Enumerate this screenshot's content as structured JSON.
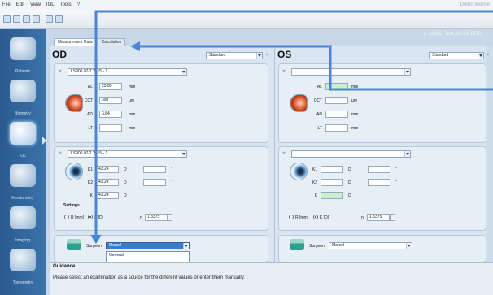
{
  "menu": {
    "items": [
      "File",
      "Edit",
      "View",
      "IOL",
      "Tools",
      "?"
    ],
    "watermark": "Demo license"
  },
  "patient": {
    "label": "12345, Test, 01.01.1950"
  },
  "sidebar": [
    {
      "label": "Patients",
      "icon": "patient-icon"
    },
    {
      "label": "Biometry",
      "icon": "biometry-icon"
    },
    {
      "label": "IOL",
      "icon": "iol-icon"
    },
    {
      "label": "Keratometry",
      "icon": "keratometry-icon"
    },
    {
      "label": "Imaging",
      "icon": "imaging-icon"
    },
    {
      "label": "Tomometry",
      "icon": "tomometry-icon"
    }
  ],
  "tabs": [
    "Measurement Data",
    "Calculation"
  ],
  "od": {
    "title": "OD",
    "mode": "Standard",
    "source_top": "LS900 07/7 2015 - 1",
    "fields": [
      {
        "label": "AL",
        "value": "23.89",
        "unit": "mm"
      },
      {
        "label": "CCT",
        "value": "398",
        "unit": "µm"
      },
      {
        "label": "AD",
        "value": "3.84",
        "unit": "mm"
      },
      {
        "label": "LT",
        "value": "",
        "unit": "mm"
      }
    ],
    "source_k": "LS900 07/7 2015 - 1",
    "k_fields": [
      {
        "label": "K1",
        "value": "43.24",
        "unit": "D",
        "extra": ""
      },
      {
        "label": "K2",
        "value": "43.24",
        "unit": "D",
        "extra": ""
      },
      {
        "label": "K",
        "value": "43.24",
        "unit": "D"
      }
    ],
    "settings": {
      "title": "Settings",
      "r_label": "R [mm]",
      "k_label": "K [D]",
      "n_label": "n",
      "n_value": "1.3375"
    },
    "surgeon": {
      "label": "Surgeon",
      "value": "Marcel",
      "options": [
        "General",
        ""
      ]
    }
  },
  "os": {
    "title": "OS",
    "mode": "Standard",
    "fields": [
      {
        "label": "AL",
        "value": "",
        "unit": "mm"
      },
      {
        "label": "CCT",
        "value": "",
        "unit": "µm"
      },
      {
        "label": "AD",
        "value": "",
        "unit": "mm"
      },
      {
        "label": "LT",
        "value": "",
        "unit": "mm"
      }
    ],
    "k_fields": [
      {
        "label": "K1",
        "value": "",
        "unit": "D"
      },
      {
        "label": "K2",
        "value": "",
        "unit": "D"
      },
      {
        "label": "K",
        "value": "",
        "unit": "D"
      }
    ],
    "settings": {
      "r_label": "R [mm]",
      "k_label": "K [D]",
      "n_label": "n",
      "n_value": "1.3375"
    },
    "surgeon": {
      "label": "Surgeon",
      "value": "Marcel"
    }
  },
  "guidance": {
    "title": "Guidance",
    "text": "Please select an examination as a source for the different values or enter them manually."
  },
  "colors": {
    "accent": "#3b73aa",
    "arrow": "#4a86d4",
    "green_field": "#c9f0c8"
  }
}
